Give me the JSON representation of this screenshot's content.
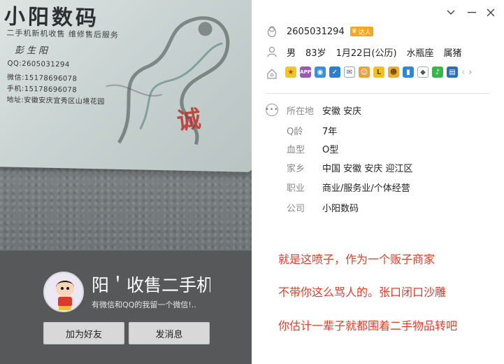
{
  "photo": {
    "card_title": "小阳数码",
    "card_subtitle": "二手机新机收售 维修售后服务",
    "card_name": "彭生阳",
    "card_lines": [
      "QQ:2605031294",
      "微信:15178696078",
      "手机:15178696078",
      "地址:安徽安庆宜秀区山境花园"
    ],
    "seal_char": "诚"
  },
  "profile": {
    "nickname": "阳＇收售二手机",
    "signature": "有微信和QQ的我留一个微信!..",
    "add_friend": "加为好友",
    "send_message": "发消息"
  },
  "window": {
    "dropdown_icon": "chevron-down-icon",
    "minimize_icon": "minimize-icon",
    "close_icon": "close-icon"
  },
  "account": {
    "qq": "2605031294",
    "vip_badge": "达人",
    "gender": "男",
    "age": "83岁",
    "birthday": "1月22日(公历)",
    "zodiac": "水瓶座",
    "shengxiao": "属猪"
  },
  "details": [
    {
      "key": "所在地",
      "value": "安徽 安庆"
    },
    {
      "key": "Q龄",
      "value": "7年"
    },
    {
      "key": "血型",
      "value": "O型"
    },
    {
      "key": "家乡",
      "value": "中国 安徽 安庆 迎江区"
    },
    {
      "key": "职业",
      "value": "商业/服务业/个体经营"
    },
    {
      "key": "公司",
      "value": "小阳数码"
    }
  ],
  "notes": [
    "就是这喷子，作为一个贩子商家",
    "不带你这么骂人的。张口闭口沙雕",
    "你估计一辈子就都围着二手物品转吧"
  ],
  "colors": {
    "note_red": "#e03c2b",
    "profile_bg": "#575859"
  }
}
